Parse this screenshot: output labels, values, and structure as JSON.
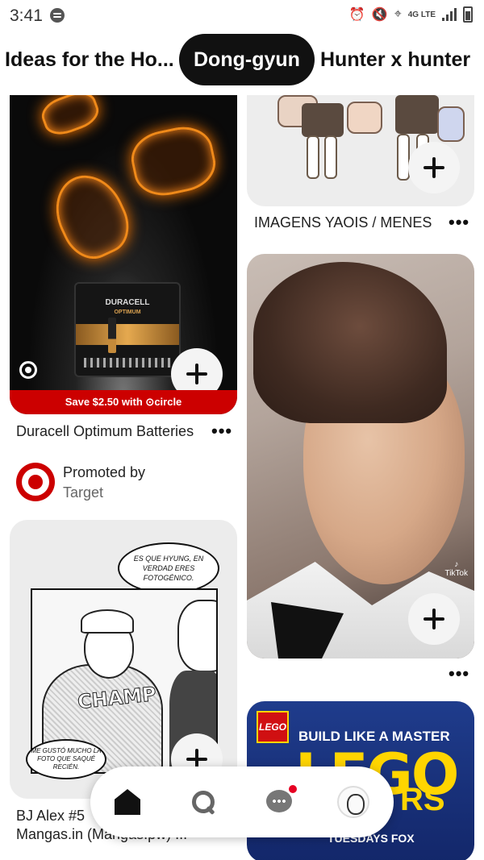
{
  "status_bar": {
    "time": "3:41",
    "network": "4G LTE",
    "icons": [
      "spotify-icon",
      "alarm-icon",
      "mute-icon",
      "location-icon",
      "signal-icon",
      "battery-icon"
    ]
  },
  "tabs": [
    {
      "label": "Ideas for the Ho...",
      "selected": false
    },
    {
      "label": "Dong-gyun",
      "selected": true
    },
    {
      "label": "Hunter x hunter",
      "selected": false
    }
  ],
  "feed": {
    "left": [
      {
        "id": "duracell",
        "image_text": {
          "brand": "DURACELL",
          "sub": "OPTIMUM"
        },
        "promo_bar": "Save $2.50 with ⊙circle",
        "title": "Duracell Optimum Batteries",
        "promoted_label": "Promoted by",
        "promoter": "Target"
      },
      {
        "id": "manga",
        "bubble_top": "ES QUE HYUNG, EN VERDAD ERES FOTOGÉNICO.",
        "bubble_bottom": "ME GUSTÓ MUCHO LA FOTO QUE SAQUÉ RECIÉN.",
        "shirt_text": "CHAMP",
        "title_line1": "BJ Alex  #5",
        "title_line2": "Mangas.in (Mangas.pw)  ..."
      }
    ],
    "right": [
      {
        "id": "chibi",
        "title": "IMAGENS YAOIS / MENES"
      },
      {
        "id": "portrait",
        "watermark": "TikTok"
      },
      {
        "id": "lego",
        "logo": "LEGO",
        "tagline": "BUILD LIKE A MASTER",
        "headline": "LEGO",
        "headline2": "RS",
        "footer": "TUESDAYS FOX"
      }
    ]
  },
  "more_label": "•••",
  "nav": {
    "items": [
      "home-icon",
      "search-icon",
      "messages-icon",
      "profile-avatar"
    ],
    "active": "home",
    "colors": {
      "active": "#111111",
      "inactive": "#666666",
      "badge": "#e60023"
    }
  },
  "colors": {
    "promo_red": "#cc0000",
    "lego_blue": "#1f3c8c",
    "lego_yellow": "#ffd500"
  }
}
